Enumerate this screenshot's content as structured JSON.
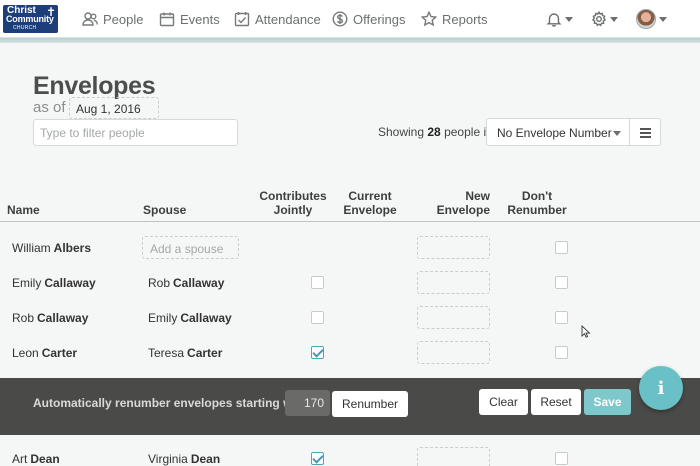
{
  "nav": {
    "logo_line1": "Christ",
    "logo_line2": "Community",
    "logo_line3": "CHURCH",
    "items": [
      {
        "label": "People",
        "icon": "people-icon"
      },
      {
        "label": "Events",
        "icon": "calendar-icon"
      },
      {
        "label": "Attendance",
        "icon": "checklist-icon"
      },
      {
        "label": "Offerings",
        "icon": "dollar-icon"
      },
      {
        "label": "Reports",
        "icon": "star-icon"
      }
    ],
    "right": [
      "bell-icon",
      "gear-icon",
      "avatar"
    ]
  },
  "header": {
    "title": "Envelopes",
    "as_of_label": "as of",
    "date": "Aug 1, 2016",
    "filter_placeholder": "Type to filter people",
    "showing_prefix": "Showing",
    "showing_count": "28",
    "showing_suffix": "people in",
    "envelope_filter": "No Envelope Number"
  },
  "table": {
    "columns": {
      "name": "Name",
      "spouse": "Spouse",
      "jointly": "Contributes Jointly",
      "current": "Current Envelope",
      "new": "New Envelope",
      "renumber": "Don't Renumber"
    },
    "add_spouse_label": "Add a spouse",
    "rows": [
      {
        "first": "William",
        "last": "Albers",
        "spouse_first": "",
        "spouse_last": "",
        "jointly": null,
        "renumber": false
      },
      {
        "first": "Emily",
        "last": "Callaway",
        "spouse_first": "Rob",
        "spouse_last": "Callaway",
        "jointly": false,
        "renumber": false
      },
      {
        "first": "Rob",
        "last": "Callaway",
        "spouse_first": "Emily",
        "spouse_last": "Callaway",
        "jointly": false,
        "renumber": false
      },
      {
        "first": "Leon",
        "last": "Carter",
        "spouse_first": "Teresa",
        "spouse_last": "Carter",
        "jointly": true,
        "renumber": false
      },
      {
        "first": "Art",
        "last": "Dean",
        "spouse_first": "Virginia",
        "spouse_last": "Dean",
        "jointly": true,
        "renumber": false
      }
    ]
  },
  "actionbar": {
    "label": "Automatically renumber envelopes starting with",
    "start_value": "170",
    "renumber": "Renumber",
    "clear": "Clear",
    "reset": "Reset",
    "save": "Save"
  },
  "info_button": "i",
  "colors": {
    "accent": "#69c0c6",
    "logo_bg": "#1c3f7a",
    "actionbar_bg": "#4a4a48"
  }
}
